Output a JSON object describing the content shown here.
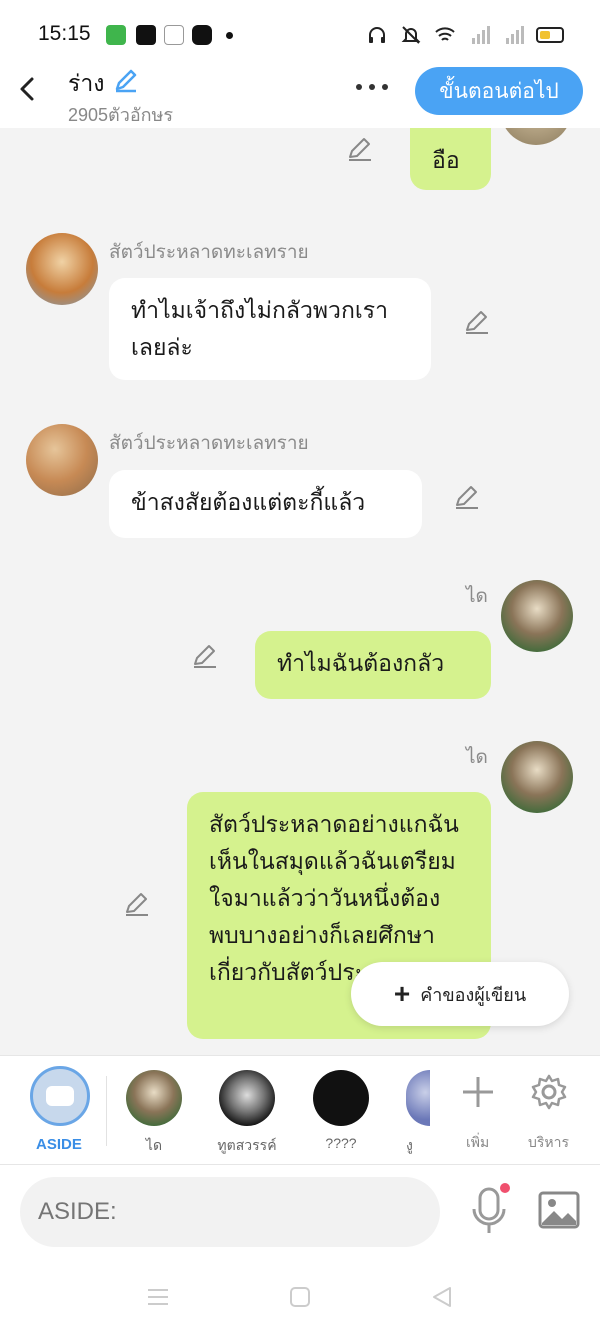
{
  "status_bar": {
    "time": "15:15",
    "icons": [
      "wechat-icon",
      "facebook-icon",
      "game-icon",
      "bunny-icon",
      "headphones-icon",
      "mute-icon",
      "wifi-icon",
      "signal-icon",
      "signal-icon",
      "battery-icon"
    ]
  },
  "header": {
    "title": "ร่าง",
    "char_count": "2905ตัวอักษร",
    "next_label": "ขั้นตอนต่อไป"
  },
  "messages": [
    {
      "side": "out",
      "sender": "",
      "text": "อือ"
    },
    {
      "side": "in",
      "sender": "สัตว์ประหลาดทะเลทราย",
      "text": "ทำไมเจ้าถึงไม่กลัวพวกเราเลยล่ะ"
    },
    {
      "side": "in",
      "sender": "สัตว์ประหลาดทะเลทราย",
      "text": "ข้าสงสัยต้องแต่ตะกี้แล้ว"
    },
    {
      "side": "out",
      "sender": "ได",
      "text": "ทำไมฉันต้องกลัว"
    },
    {
      "side": "out",
      "sender": "ได",
      "text": "สัตว์ประหลาดอย่างแกฉันเห็นในสมุดแล้วฉันเตรียมใจมาแล้วว่าวันหนึ่งต้องพบบางอย่างก็เลยศึกษาเกี่ยวกับสัตว์ประหลาด"
    }
  ],
  "author_note_label": "คำของผู้เขียน",
  "character_bar": {
    "aside_label": "ASIDE",
    "characters": [
      {
        "name": "ได"
      },
      {
        "name": "ทูตสวรรค์"
      },
      {
        "name": "????"
      },
      {
        "name": "งู"
      }
    ],
    "add_label": "เพิ่ม",
    "manage_label": "บริหาร"
  },
  "input": {
    "placeholder": "ASIDE:"
  },
  "colors": {
    "accent": "#4aa3f4",
    "outgoing_bubble": "#d5f28e",
    "incoming_bubble": "#ffffff",
    "background": "#f3f3f3"
  }
}
